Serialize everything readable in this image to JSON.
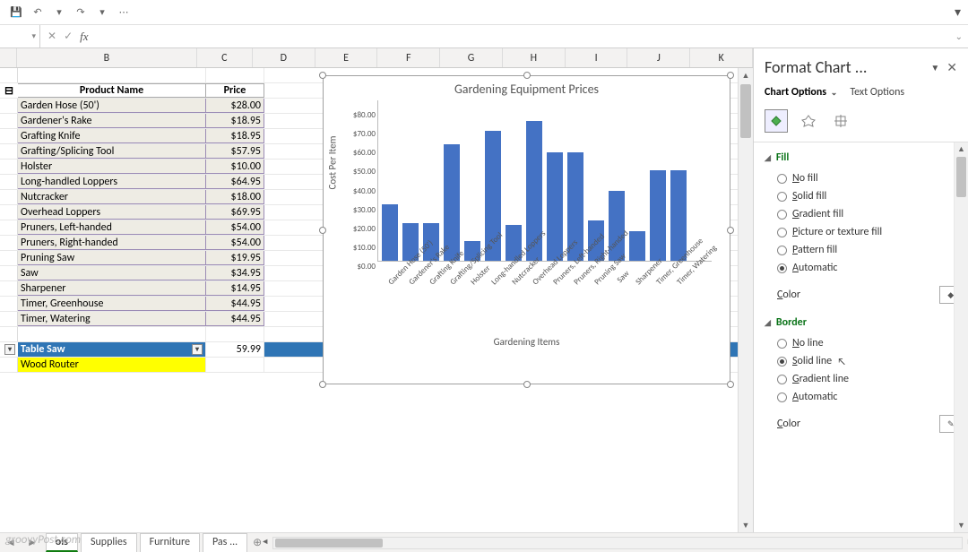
{
  "toolbar": {
    "save": "💾",
    "undo": "↶",
    "redo": "↷"
  },
  "formula_bar": {
    "name_box": "",
    "fx": "fx"
  },
  "columns": [
    "",
    "B",
    "C",
    "D",
    "E",
    "F",
    "G",
    "H",
    "I",
    "J",
    "K"
  ],
  "table": {
    "headers": {
      "name": "Product Name",
      "price": "Price"
    },
    "rows": [
      {
        "name": "Garden Hose (50')",
        "price": "$28.00"
      },
      {
        "name": "Gardener's Rake",
        "price": "$18.95"
      },
      {
        "name": "Grafting Knife",
        "price": "$18.95"
      },
      {
        "name": "Grafting/Splicing Tool",
        "price": "$57.95"
      },
      {
        "name": "Holster",
        "price": "$10.00"
      },
      {
        "name": "Long-handled Loppers",
        "price": "$64.95"
      },
      {
        "name": "Nutcracker",
        "price": "$18.00"
      },
      {
        "name": "Overhead Loppers",
        "price": "$69.95"
      },
      {
        "name": "Pruners, Left-handed",
        "price": "$54.00"
      },
      {
        "name": "Pruners, Right-handed",
        "price": "$54.00"
      },
      {
        "name": "Pruning Saw",
        "price": "$19.95"
      },
      {
        "name": "Saw",
        "price": "$34.95"
      },
      {
        "name": "Sharpener",
        "price": "$14.95"
      },
      {
        "name": "Timer, Greenhouse",
        "price": "$44.95"
      },
      {
        "name": "Timer, Watering",
        "price": "$44.95"
      }
    ],
    "total_row": {
      "label": "Table Saw",
      "value": "59.99"
    },
    "yellow_row": {
      "label": "Wood Router"
    }
  },
  "chart_data": {
    "type": "bar",
    "title": "Gardening Equipment Prices",
    "xlabel": "Gardening Items",
    "ylabel": "Cost Per Item",
    "ylim": [
      0,
      80
    ],
    "yticks": [
      "$80.00",
      "$70.00",
      "$60.00",
      "$50.00",
      "$40.00",
      "$30.00",
      "$20.00",
      "$10.00",
      "$0.00"
    ],
    "categories": [
      "Garden Hose (50')",
      "Gardener's Rake",
      "Grafting Knife",
      "Grafting/Splicing Tool",
      "Holster",
      "Long-handled Loppers",
      "Nutcracker",
      "Overhead Loppers",
      "Pruners, Left-handed",
      "Pruners, Right-handed",
      "Pruning Saw",
      "Saw",
      "Sharpener",
      "Timer, Greenhouse",
      "Timer, Watering"
    ],
    "values": [
      28.0,
      18.95,
      18.95,
      57.95,
      10.0,
      64.95,
      18.0,
      69.95,
      54.0,
      54.0,
      19.95,
      34.95,
      14.95,
      44.95,
      44.95
    ]
  },
  "sheet_tabs": {
    "active": "ols",
    "tabs": [
      "ols",
      "Supplies",
      "Furniture",
      "Pas ..."
    ]
  },
  "pane": {
    "title": "Format Chart ...",
    "tab1": "Chart Options",
    "tab2": "Text Options",
    "fill": {
      "head": "Fill",
      "opts": [
        "No fill",
        "Solid fill",
        "Gradient fill",
        "Picture or texture fill",
        "Pattern fill",
        "Automatic"
      ],
      "selected": 5,
      "color_label": "Color"
    },
    "border": {
      "head": "Border",
      "opts": [
        "No line",
        "Solid line",
        "Gradient line",
        "Automatic"
      ],
      "selected": 1,
      "color_label": "Color"
    }
  },
  "watermark": "groovyPost.com"
}
